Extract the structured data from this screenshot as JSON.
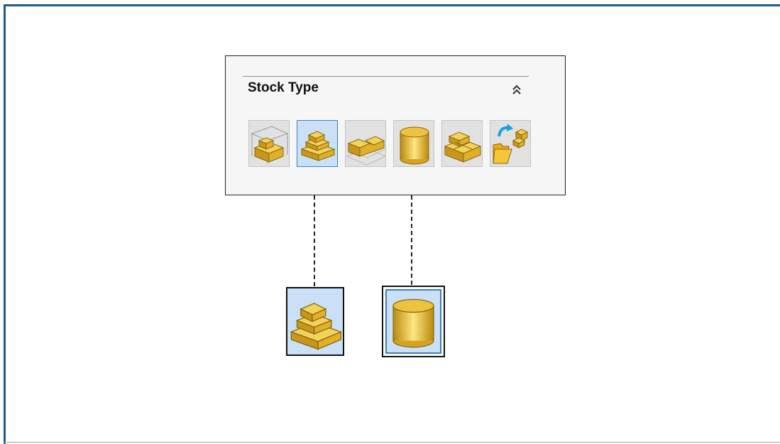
{
  "panel": {
    "title": "Stock Type",
    "collapse_icon": "double-chevron-up-icon",
    "options": [
      {
        "icon": "bounding-box-stock-icon",
        "selected": false
      },
      {
        "icon": "stepped-block-stock-icon",
        "selected": true
      },
      {
        "icon": "extruded-profile-stock-icon",
        "selected": false
      },
      {
        "icon": "cylinder-stock-icon",
        "selected": false
      },
      {
        "icon": "sketch-blocks-stock-icon",
        "selected": false
      },
      {
        "icon": "stock-from-file-icon",
        "selected": false
      }
    ]
  },
  "callouts": [
    {
      "icon": "stepped-block-stock-icon"
    },
    {
      "icon": "cylinder-stock-icon"
    }
  ],
  "colors": {
    "frame": "#1f5a8a",
    "gold": "#e8b92a",
    "selection": "#c9e0f6"
  }
}
